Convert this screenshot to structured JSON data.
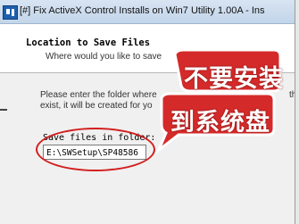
{
  "window": {
    "title": "[#] Fix ActiveX Control Installs on Win7 Utility 1.00A - Ins"
  },
  "header": {
    "heading": "Location to Save Files",
    "subheading": "Where would you like to save"
  },
  "body": {
    "description_line1": "Please enter the folder where",
    "description_line1_tail": "th",
    "description_line2": "exist, it will be created for yo"
  },
  "folder": {
    "label": "Save files in folder:",
    "value": "E:\\SWSetup\\SP48586"
  },
  "annotation": {
    "line1": "不要安装",
    "line2": "到系统盘",
    "bubble_color": "#d52a2a",
    "ellipse_color": "#d21e1e"
  },
  "icons": {
    "app": "installer-app-icon"
  }
}
